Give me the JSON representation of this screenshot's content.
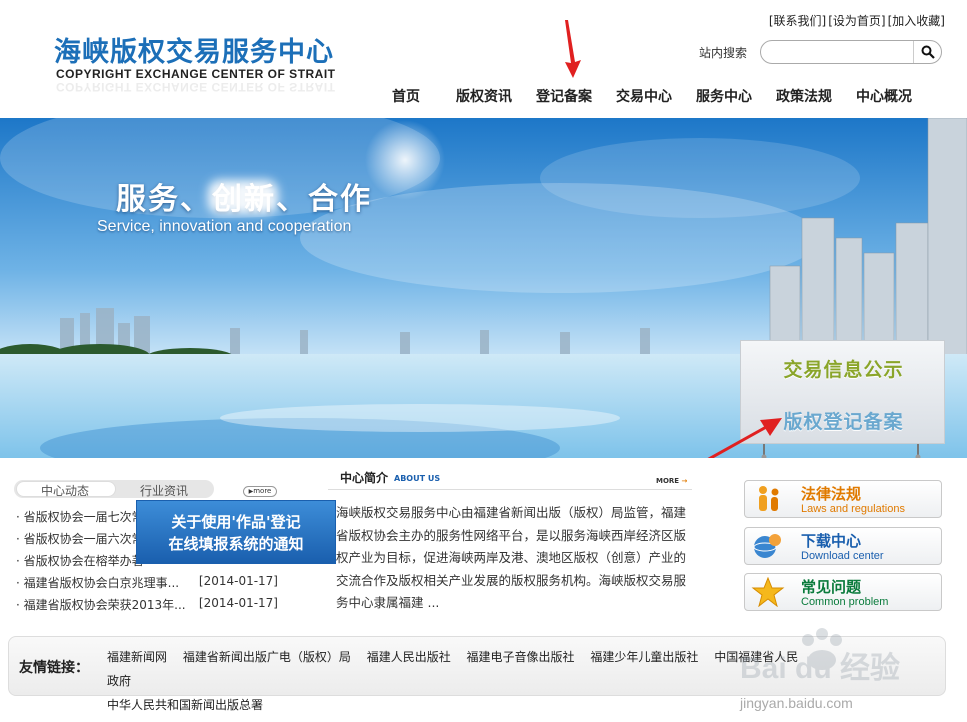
{
  "header": {
    "logo_cn": "海峡版权交易服务中心",
    "logo_en": "COPYRIGHT EXCHANGE CENTER OF STRAIT",
    "top_links": [
      "[联系我们]",
      "[设为首页]",
      "[加入收藏]"
    ],
    "search_label": "站内搜索",
    "search_value": "",
    "search_icon": "search-icon"
  },
  "nav": [
    "首页",
    "版权资讯",
    "登记备案",
    "交易中心",
    "服务中心",
    "政策法规",
    "中心概况"
  ],
  "banner": {
    "slogan_cn": "服务、创新、合作",
    "slogan_en": "Service, innovation and cooperation",
    "panel_items": [
      "交易信息公示",
      "版权登记备案"
    ]
  },
  "news": {
    "tabs": [
      "中心动态",
      "行业资讯"
    ],
    "more_label": "more",
    "items": [
      {
        "title": "· 省版权协会一届七次常",
        "date": ""
      },
      {
        "title": "· 省版权协会一届六次常",
        "date": ""
      },
      {
        "title": "· 省版权协会在榕举办著",
        "date": ""
      },
      {
        "title": "· 福建省版权协会白京兆理事...",
        "date": "[2014-01-17]"
      },
      {
        "title": "· 福建省版权协会荣获2013年...",
        "date": "[2014-01-17]"
      }
    ],
    "notice_line1": "关于使用'作品'登记",
    "notice_line2": "在线填报系统的通知"
  },
  "intro": {
    "title": "中心简介",
    "title_en": "ABOUT US",
    "more_label": "MORE",
    "text": "海峡版权交易服务中心由福建省新闻出版（版权）局监管，福建省版权协会主办的服务性网络平台，是以服务海峡西岸经济区版权产业为目标，促进海峡两岸及港、澳地区版权（创意）产业的交流合作及版权相关产业发展的版权服务机构。海峡版权交易服务中心隶属福建 ..."
  },
  "services": [
    {
      "cn": "法律法规",
      "en": "Laws and regulations",
      "color": "#e07a00"
    },
    {
      "cn": "下载中心",
      "en": "Download center",
      "color": "#1a5fae"
    },
    {
      "cn": "常见问题",
      "en": "Common problem",
      "color": "#0a7b3c"
    }
  ],
  "links": {
    "label": "友情链接：",
    "items": [
      "福建新闻网",
      "福建省新闻出版广电（版权）局",
      "福建人民出版社",
      "福建电子音像出版社",
      "福建少年儿童出版社",
      "中国福建省人民政府",
      "中华人民共和国新闻出版总署"
    ]
  },
  "watermark": {
    "text": "Bai du 经验",
    "url": "jingyan.baidu.com"
  },
  "colors": {
    "brand_blue": "#1c6fb8",
    "arrow_red": "#e02020",
    "trade_green": "#8aa52a"
  }
}
